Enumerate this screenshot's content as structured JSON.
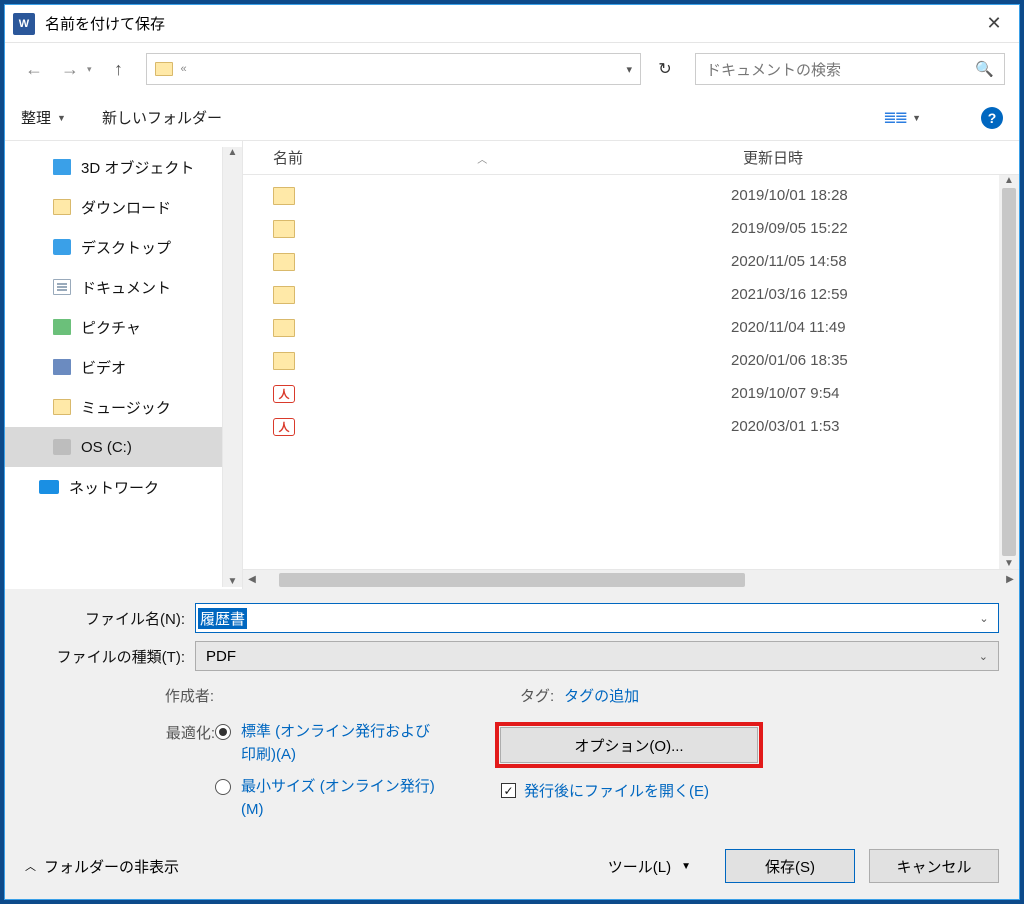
{
  "title": "名前を付けて保存",
  "address": {
    "chev": "«"
  },
  "search": {
    "placeholder": "ドキュメントの検索"
  },
  "toolbar": {
    "organize": "整理",
    "newfolder": "新しいフォルダー"
  },
  "tree": {
    "items": [
      {
        "label": "3D オブジェクト",
        "icon": "ico-3d"
      },
      {
        "label": "ダウンロード",
        "icon": "ico-folder"
      },
      {
        "label": "デスクトップ",
        "icon": "ico-blue"
      },
      {
        "label": "ドキュメント",
        "icon": "ico-doc"
      },
      {
        "label": "ピクチャ",
        "icon": "ico-pic"
      },
      {
        "label": "ビデオ",
        "icon": "ico-vid"
      },
      {
        "label": "ミュージック",
        "icon": "ico-folder"
      },
      {
        "label": "OS (C:)",
        "icon": "ico-drive",
        "selected": true
      },
      {
        "label": "ネットワーク",
        "icon": "ico-netw",
        "net": true
      }
    ]
  },
  "columns": {
    "name": "名前",
    "date": "更新日時"
  },
  "files": [
    {
      "type": "folder",
      "date": "2019/10/01 18:28"
    },
    {
      "type": "folder",
      "date": "2019/09/05 15:22"
    },
    {
      "type": "folder",
      "date": "2020/11/05 14:58"
    },
    {
      "type": "folder",
      "date": "2021/03/16 12:59"
    },
    {
      "type": "folder",
      "date": "2020/11/04 11:49"
    },
    {
      "type": "folder",
      "date": "2020/01/06 18:35"
    },
    {
      "type": "pdf",
      "date": "2019/10/07 9:54"
    },
    {
      "type": "pdf",
      "date": "2020/03/01 1:53"
    }
  ],
  "form": {
    "fn_label": "ファイル名(N):",
    "fn_value": "履歴書",
    "ft_label": "ファイルの種類(T):",
    "ft_value": "PDF",
    "author_label": "作成者:",
    "tag_label": "タグ:",
    "tag_link": "タグの追加",
    "optimize_label": "最適化:",
    "radio_standard": "標準 (オンライン発行および印刷)(A)",
    "radio_minimum": "最小サイズ (オンライン発行)(M)",
    "options_btn": "オプション(O)...",
    "open_after": "発行後にファイルを開く(E)"
  },
  "footer": {
    "hide_folders": "フォルダーの非表示",
    "tools": "ツール(L)",
    "save": "保存(S)",
    "cancel": "キャンセル"
  }
}
